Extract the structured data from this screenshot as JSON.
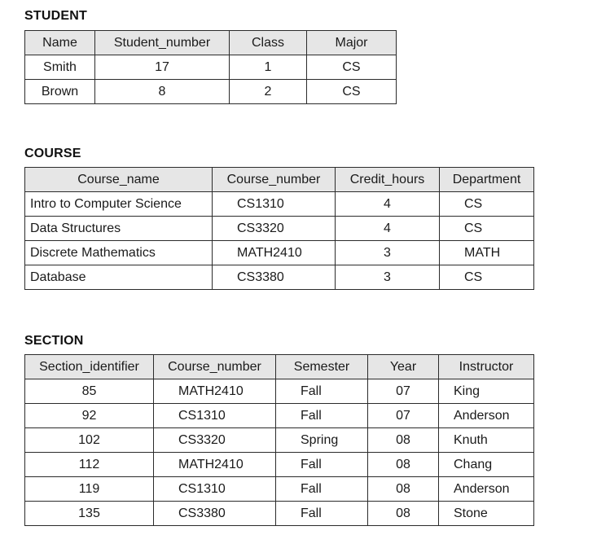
{
  "student": {
    "title": "STUDENT",
    "headers": [
      "Name",
      "Student_number",
      "Class",
      "Major"
    ],
    "rows": [
      [
        "Smith",
        "17",
        "1",
        "CS"
      ],
      [
        "Brown",
        "8",
        "2",
        "CS"
      ]
    ]
  },
  "course": {
    "title": "COURSE",
    "headers": [
      "Course_name",
      "Course_number",
      "Credit_hours",
      "Department"
    ],
    "rows": [
      [
        "Intro to Computer Science",
        "CS1310",
        "4",
        "CS"
      ],
      [
        "Data Structures",
        "CS3320",
        "4",
        "CS"
      ],
      [
        "Discrete Mathematics",
        "MATH2410",
        "3",
        "MATH"
      ],
      [
        "Database",
        "CS3380",
        "3",
        "CS"
      ]
    ]
  },
  "section": {
    "title": "SECTION",
    "headers": [
      "Section_identifier",
      "Course_number",
      "Semester",
      "Year",
      "Instructor"
    ],
    "rows": [
      [
        "85",
        "MATH2410",
        "Fall",
        "07",
        "King"
      ],
      [
        "92",
        "CS1310",
        "Fall",
        "07",
        "Anderson"
      ],
      [
        "102",
        "CS3320",
        "Spring",
        "08",
        "Knuth"
      ],
      [
        "112",
        "MATH2410",
        "Fall",
        "08",
        "Chang"
      ],
      [
        "119",
        "CS1310",
        "Fall",
        "08",
        "Anderson"
      ],
      [
        "135",
        "CS3380",
        "Fall",
        "08",
        "Stone"
      ]
    ]
  }
}
